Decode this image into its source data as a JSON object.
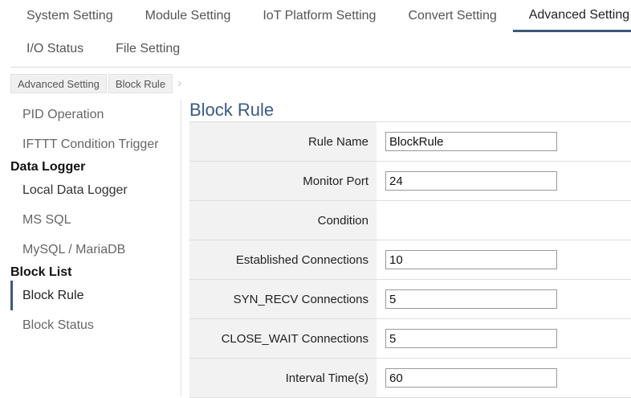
{
  "tabs_row1": [
    {
      "label": "System Setting",
      "active": false
    },
    {
      "label": "Module Setting",
      "active": false
    },
    {
      "label": "IoT Platform Setting",
      "active": false
    },
    {
      "label": "Convert Setting",
      "active": false
    },
    {
      "label": "Advanced Setting",
      "active": true
    }
  ],
  "tabs_row2": [
    {
      "label": "I/O Status"
    },
    {
      "label": "File Setting"
    }
  ],
  "breadcrumb": [
    "Advanced Setting",
    "Block Rule"
  ],
  "sidebar": {
    "item_pid": "PID Operation",
    "item_ifttt": "IFTTT Condition Trigger",
    "group_data_logger": "Data Logger",
    "item_local": "Local Data Logger",
    "item_mssql": "MS SQL",
    "item_mysql": "MySQL / MariaDB",
    "group_block_list": "Block List",
    "item_block_rule": "Block Rule",
    "item_block_status": "Block Status"
  },
  "main": {
    "title": "Block Rule",
    "rows": [
      {
        "label": "Rule Name",
        "value": "BlockRule"
      },
      {
        "label": "Monitor Port",
        "value": "24"
      },
      {
        "label": "Condition",
        "value": null
      },
      {
        "label": "Established Connections",
        "value": "10"
      },
      {
        "label": "SYN_RECV Connections",
        "value": "5"
      },
      {
        "label": "CLOSE_WAIT Connections",
        "value": "5"
      },
      {
        "label": "Interval Time(s)",
        "value": "60"
      }
    ]
  },
  "colors": {
    "accent": "#3a5a7a",
    "title": "#3a5a86",
    "label_bg": "#f2f2f2"
  }
}
